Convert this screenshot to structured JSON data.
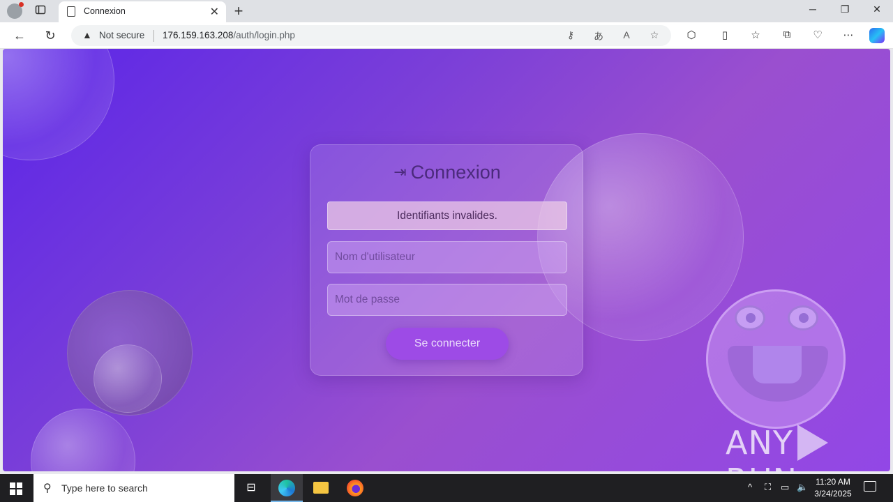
{
  "browser": {
    "tab_title": "Connexion",
    "security_label": "Not secure",
    "url_host": "176.159.163.208",
    "url_path": "/auth/login.php"
  },
  "page": {
    "heading": "Connexion",
    "alert": "Identifiants invalides.",
    "username_placeholder": "Nom d'utilisateur",
    "password_placeholder": "Mot de passe",
    "submit_label": "Se connecter",
    "watermark_left": "ANY",
    "watermark_right": "RUN"
  },
  "taskbar": {
    "search_placeholder": "Type here to search",
    "time": "11:20 AM",
    "date": "3/24/2025"
  },
  "colors": {
    "bg_start": "#5b25e8",
    "bg_end": "#9247e6",
    "button": "#9d4be6"
  }
}
